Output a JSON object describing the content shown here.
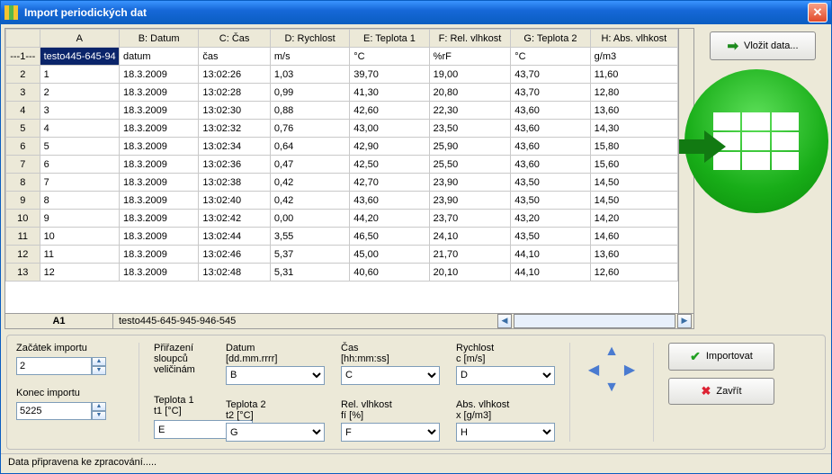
{
  "window": {
    "title": "Import periodických dat"
  },
  "buttons": {
    "vlozit": "Vložit data...",
    "importovat": "Importovat",
    "zavrit": "Zavřít"
  },
  "grid": {
    "columns": [
      "A",
      "B: Datum",
      "C: Čas",
      "D: Rychlost",
      "E: Teplota 1",
      "F: Rel. vlhkost",
      "G: Teplota 2",
      "H: Abs. vlhkost"
    ],
    "header_row_label": "---1---",
    "header_row": [
      "testo445-645-94",
      "datum",
      "čas",
      "m/s",
      "°C",
      "%rF",
      "°C",
      "g/m3"
    ],
    "rows": [
      {
        "n": "2",
        "c": [
          "1",
          "18.3.2009",
          "13:02:26",
          "1,03",
          "39,70",
          "19,00",
          "43,70",
          "11,60"
        ]
      },
      {
        "n": "3",
        "c": [
          "2",
          "18.3.2009",
          "13:02:28",
          "0,99",
          "41,30",
          "20,80",
          "43,70",
          "12,80"
        ]
      },
      {
        "n": "4",
        "c": [
          "3",
          "18.3.2009",
          "13:02:30",
          "0,88",
          "42,60",
          "22,30",
          "43,60",
          "13,60"
        ]
      },
      {
        "n": "5",
        "c": [
          "4",
          "18.3.2009",
          "13:02:32",
          "0,76",
          "43,00",
          "23,50",
          "43,60",
          "14,30"
        ]
      },
      {
        "n": "6",
        "c": [
          "5",
          "18.3.2009",
          "13:02:34",
          "0,64",
          "42,90",
          "25,90",
          "43,60",
          "15,80"
        ]
      },
      {
        "n": "7",
        "c": [
          "6",
          "18.3.2009",
          "13:02:36",
          "0,47",
          "42,50",
          "25,50",
          "43,60",
          "15,60"
        ]
      },
      {
        "n": "8",
        "c": [
          "7",
          "18.3.2009",
          "13:02:38",
          "0,42",
          "42,70",
          "23,90",
          "43,50",
          "14,50"
        ]
      },
      {
        "n": "9",
        "c": [
          "8",
          "18.3.2009",
          "13:02:40",
          "0,42",
          "43,60",
          "23,90",
          "43,50",
          "14,50"
        ]
      },
      {
        "n": "10",
        "c": [
          "9",
          "18.3.2009",
          "13:02:42",
          "0,00",
          "44,20",
          "23,70",
          "43,20",
          "14,20"
        ]
      },
      {
        "n": "11",
        "c": [
          "10",
          "18.3.2009",
          "13:02:44",
          "3,55",
          "46,50",
          "24,10",
          "43,50",
          "14,60"
        ]
      },
      {
        "n": "12",
        "c": [
          "11",
          "18.3.2009",
          "13:02:46",
          "5,37",
          "45,00",
          "21,70",
          "44,10",
          "13,60"
        ]
      },
      {
        "n": "13",
        "c": [
          "12",
          "18.3.2009",
          "13:02:48",
          "5,31",
          "40,60",
          "20,10",
          "44,10",
          "12,60"
        ]
      }
    ],
    "cell_ref": "A1",
    "cell_value": "testo445-645-945-946-545"
  },
  "form": {
    "zacatek_label": "Začátek importu",
    "zacatek_value": "2",
    "konec_label": "Konec importu",
    "konec_value": "5225",
    "prirazeni_label": "Přiřazení sloupců veličinám",
    "datum": {
      "label": "Datum",
      "unit": "[dd.mm.rrrr]",
      "value": "B"
    },
    "cas": {
      "label": "Čas",
      "unit": "[hh:mm:ss]",
      "value": "C"
    },
    "rychlost": {
      "label": "Rychlost",
      "unit": "c [m/s]",
      "value": "D"
    },
    "teplota1": {
      "label": "Teplota 1",
      "unit": "t1 [°C]",
      "value": "E"
    },
    "teplota2": {
      "label": "Teplota 2",
      "unit": "t2 [°C]",
      "value": "G"
    },
    "relvlh": {
      "label": "Rel. vlhkost",
      "unit": "fí [%]",
      "value": "F"
    },
    "absvlh": {
      "label": "Abs. vlhkost",
      "unit": "x [g/m3]",
      "value": "H"
    }
  },
  "status": "Data připravena ke zpracování....."
}
